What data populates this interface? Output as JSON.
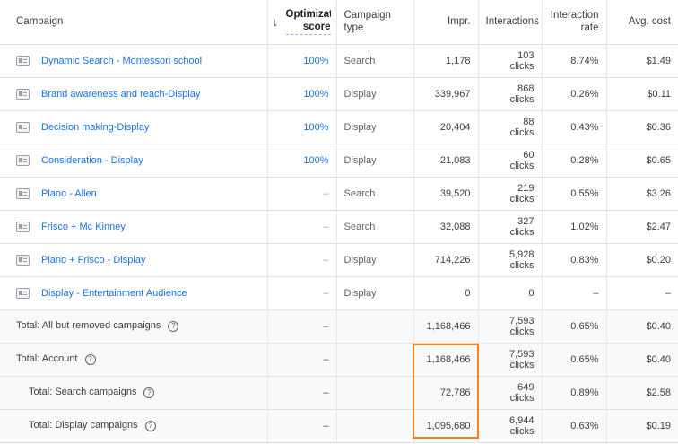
{
  "columns": {
    "campaign": "Campaign",
    "optimization": "Optimization score",
    "sort_icon": "arrow-down-icon",
    "campaign_type": "Campaign type",
    "impressions": "Impr.",
    "interactions": "Interactions",
    "interaction_rate": "Interaction rate",
    "avg_cost": "Avg. cost"
  },
  "rows": [
    {
      "name": "Dynamic Search - Montessori school",
      "opt": "100%",
      "type": "Search",
      "impr": "1,178",
      "int_count": "103",
      "int_unit": "clicks",
      "rate": "8.74%",
      "cost": "$1.49"
    },
    {
      "name": "Brand awareness and reach-Display",
      "opt": "100%",
      "type": "Display",
      "impr": "339,967",
      "int_count": "868",
      "int_unit": "clicks",
      "rate": "0.26%",
      "cost": "$0.11"
    },
    {
      "name": "Decision making-Display",
      "opt": "100%",
      "type": "Display",
      "impr": "20,404",
      "int_count": "88",
      "int_unit": "clicks",
      "rate": "0.43%",
      "cost": "$0.36"
    },
    {
      "name": "Consideration - Display",
      "opt": "100%",
      "type": "Display",
      "impr": "21,083",
      "int_count": "60",
      "int_unit": "clicks",
      "rate": "0.28%",
      "cost": "$0.65"
    },
    {
      "name": "Plano - Allen",
      "opt": "–",
      "type": "Search",
      "impr": "39,520",
      "int_count": "219",
      "int_unit": "clicks",
      "rate": "0.55%",
      "cost": "$3.26"
    },
    {
      "name": "Frisco + Mc Kinney",
      "opt": "–",
      "type": "Search",
      "impr": "32,088",
      "int_count": "327",
      "int_unit": "clicks",
      "rate": "1.02%",
      "cost": "$2.47"
    },
    {
      "name": "Plano + Frisco - Display",
      "opt": "–",
      "type": "Display",
      "impr": "714,226",
      "int_count": "5,928",
      "int_unit": "clicks",
      "rate": "0.83%",
      "cost": "$0.20"
    },
    {
      "name": "Display - Entertainment Audience",
      "opt": "–",
      "type": "Display",
      "impr": "0",
      "int_count": "0",
      "int_unit": "",
      "rate": "–",
      "cost": "–"
    }
  ],
  "totals": [
    {
      "label": "Total: All but removed campaigns",
      "opt": "–",
      "impr": "1,168,466",
      "int_count": "7,593",
      "int_unit": "clicks",
      "rate": "0.65%",
      "cost": "$0.40"
    },
    {
      "label": "Total: Account",
      "opt": "–",
      "impr": "1,168,466",
      "int_count": "7,593",
      "int_unit": "clicks",
      "rate": "0.65%",
      "cost": "$0.40"
    },
    {
      "label": "Total: Search campaigns",
      "opt": "–",
      "impr": "72,786",
      "int_count": "649",
      "int_unit": "clicks",
      "rate": "0.89%",
      "cost": "$2.58"
    },
    {
      "label": "Total: Display campaigns",
      "opt": "–",
      "impr": "1,095,680",
      "int_count": "6,944",
      "int_unit": "clicks",
      "rate": "0.63%",
      "cost": "$0.19"
    }
  ],
  "help_icon": "?",
  "highlight_color": "#f5821f",
  "link_color": "#1a73e8"
}
